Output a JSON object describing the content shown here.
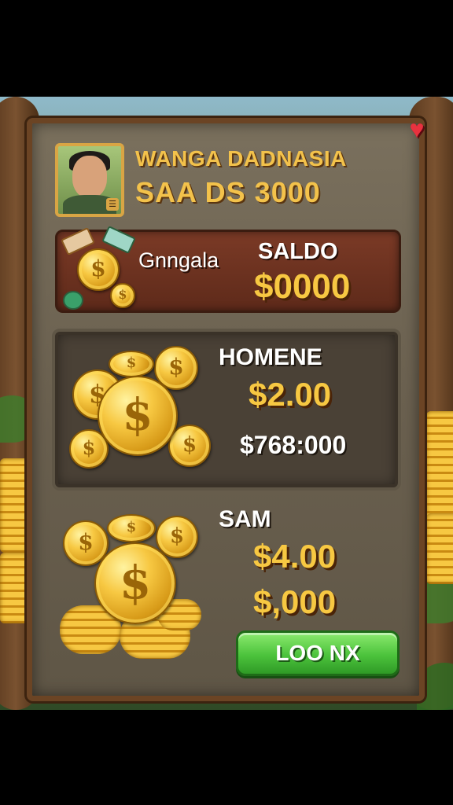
{
  "player": {
    "name": "WANGA DADNASIA",
    "subtitle": "SAA DS 3000"
  },
  "balance": {
    "label": "Gnngala",
    "saldo_label": "SALDO",
    "saldo_value": "$0000"
  },
  "offers": [
    {
      "title": "HOMENE",
      "price": "$2.00",
      "amount": "$768:000"
    },
    {
      "title": "SAM",
      "price": "$4.00",
      "amount": "$,000"
    }
  ],
  "buy_button": {
    "label": "LOO NX"
  },
  "icons": {
    "coin_symbol": "$",
    "heart": "♥"
  },
  "colors": {
    "gold": "#f7c842",
    "panel": "#6a604f",
    "balance_box": "#6b3020",
    "button_green": "#4cc33c",
    "heart_red": "#e8323f"
  }
}
